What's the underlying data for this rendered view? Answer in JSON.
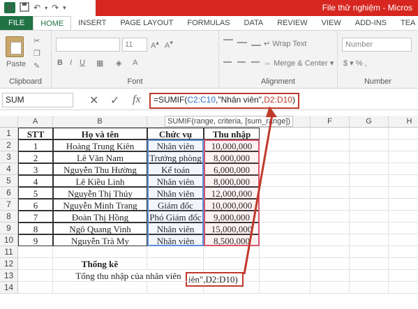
{
  "app": {
    "title": "File thử nghiệm - Micros",
    "logo": "X"
  },
  "ribbon_tabs": [
    "FILE",
    "HOME",
    "INSERT",
    "PAGE LAYOUT",
    "FORMULAS",
    "DATA",
    "REVIEW",
    "VIEW",
    "ADD-INS",
    "TEA"
  ],
  "ribbon": {
    "paste_label": "Paste",
    "clipboard_label": "Clipboard",
    "font_label": "Font",
    "font_size": "11",
    "wrap_text": "Wrap Text",
    "merge_center": "Merge & Center",
    "alignment_label": "Alignment",
    "number_format": "Number",
    "number_label": "Number"
  },
  "formula_bar": {
    "name_box": "SUM",
    "fx_label": "fx",
    "formula_prefix": "=SUMIF(",
    "range_ref": "C2:C10",
    "criteria_part": ",\"Nhân viên\",",
    "sum_range_ref": "D2:D10",
    "formula_suffix": ")",
    "tooltip": "SUMIF(range, criteria, [sum_range])"
  },
  "columns": [
    "A",
    "B",
    "C",
    "D",
    "E",
    "F",
    "G",
    "H"
  ],
  "rows": [
    "1",
    "2",
    "3",
    "4",
    "5",
    "6",
    "7",
    "8",
    "9",
    "10",
    "11",
    "12",
    "13",
    "14"
  ],
  "table": {
    "headers": [
      "STT",
      "Họ và tên",
      "Chức vụ",
      "Thu nhập"
    ],
    "rows": [
      [
        "1",
        "Hoàng Trung Kiên",
        "Nhân viên",
        "10,000,000"
      ],
      [
        "2",
        "Lê Văn Nam",
        "Trưởng phòng",
        "8,000,000"
      ],
      [
        "3",
        "Nguyễn Thu Hường",
        "Kế toán",
        "6,000,000"
      ],
      [
        "4",
        "Lê Kiều Linh",
        "Nhân viên",
        "8,000,000"
      ],
      [
        "5",
        "Nguyễn Thị Thúy",
        "Nhân viên",
        "12,000,000"
      ],
      [
        "6",
        "Nguyễn Minh Trang",
        "Giám đốc",
        "10,000,000"
      ],
      [
        "7",
        "Đoàn Thị Hồng",
        "Phó Giám đốc",
        "9,000,000"
      ],
      [
        "8",
        "Ngô Quang Vinh",
        "Nhân viên",
        "15,000,000"
      ],
      [
        "9",
        "Nguyễn Trà My",
        "Nhân viên",
        "8,500,000"
      ]
    ]
  },
  "stats": {
    "title": "Thống kê",
    "label": "Tổng thu nhập của nhân viên",
    "edit_value": "iên\",D2:D10)"
  },
  "colors": {
    "excel_green": "#217346",
    "title_red": "#d6261f",
    "range_blue": "#5b8fd6",
    "range_red": "#d6546a",
    "annotation_red": "#c0392b"
  }
}
